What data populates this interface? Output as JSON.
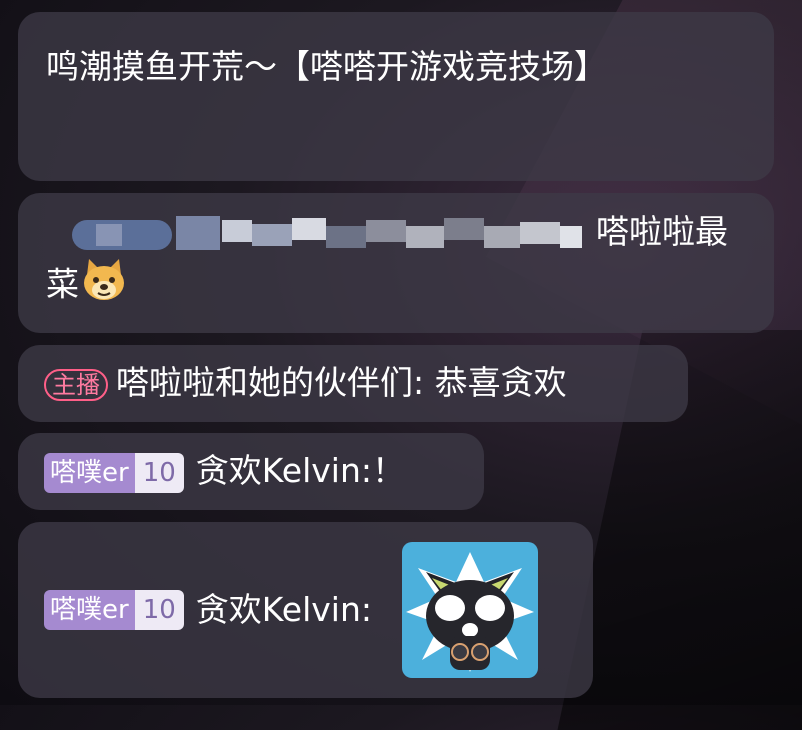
{
  "messages": {
    "m1": {
      "text": "鸣潮摸鱼开荒～【嗒嗒开游戏竞技场】"
    },
    "m2": {
      "text": "嗒啦啦最菜",
      "emoji": "doge-emoji"
    },
    "m3": {
      "badge": "主播",
      "user": "嗒啦啦和她的伙伴们:",
      "text": "恭喜贪欢"
    },
    "m4": {
      "fan_badge_name": "嗒噗er",
      "fan_badge_level": "10",
      "user": "贪欢Kelvin:",
      "text": "！"
    },
    "m5": {
      "fan_badge_name": "嗒噗er",
      "fan_badge_level": "10",
      "user": "贪欢Kelvin:",
      "sticker": "black-cat-sticker"
    }
  },
  "colors": {
    "host_badge": "#ff5f88",
    "fan_badge": "#a58ad0",
    "bubble": "#3e3a46"
  }
}
